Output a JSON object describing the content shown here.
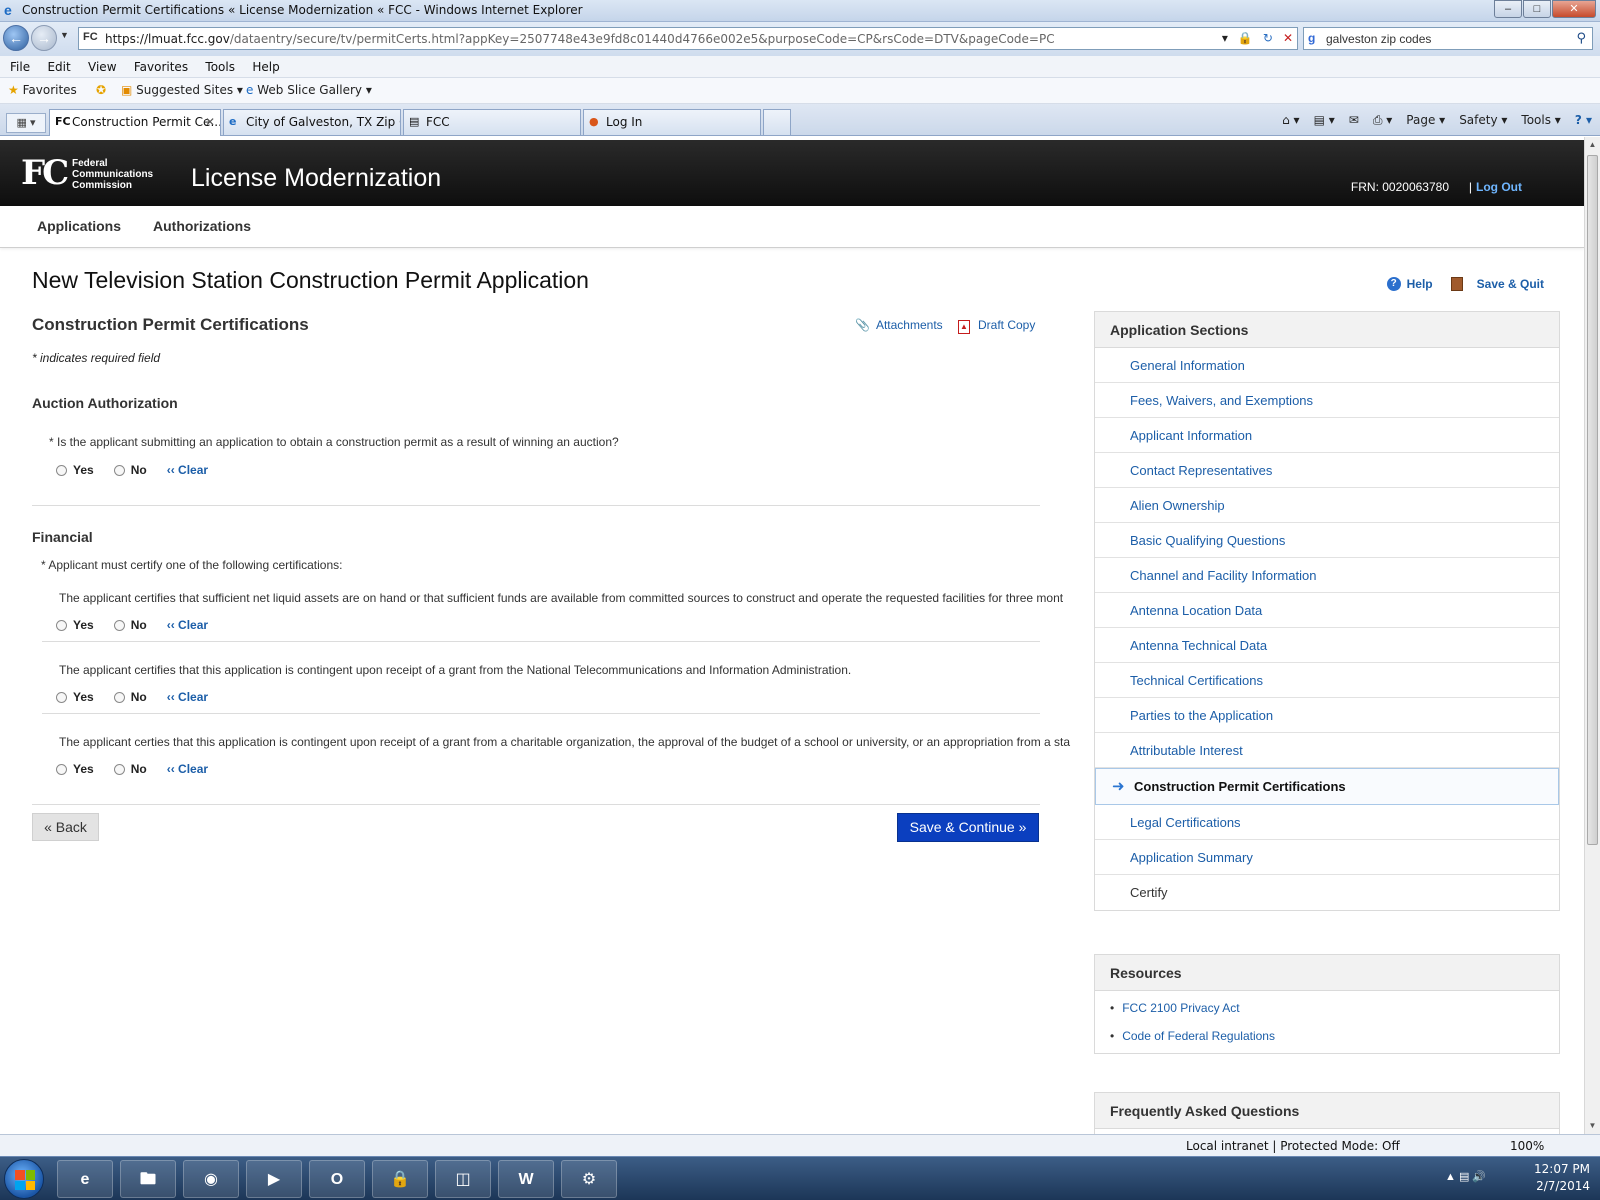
{
  "window": {
    "title": "Construction Permit Certifications « License Modernization « FCC - Windows Internet Explorer",
    "minimize": "–",
    "maximize": "□",
    "close": "✕"
  },
  "address": {
    "url_host": "https://lmuat.fcc.gov",
    "url_path": "/dataentry/secure/tv/permitCerts.html?appKey=2507748e43e9fd8c01440d4766e002e5&purposeCode=CP&rsCode=DTV&pageCode=PC",
    "search_text": "galveston zip codes"
  },
  "menubar": [
    "File",
    "Edit",
    "View",
    "Favorites",
    "Tools",
    "Help"
  ],
  "favorites_bar": {
    "favorites": "Favorites",
    "suggested": "Suggested Sites ▾",
    "webslice": "Web Slice Gallery ▾"
  },
  "tabs": [
    {
      "label": "Construction Permit Ce...",
      "icon": "FC"
    },
    {
      "label": "City of Galveston, TX Zip C...",
      "icon": "e"
    },
    {
      "label": "FCC",
      "icon": "▤"
    },
    {
      "label": "Log In",
      "icon": "●"
    }
  ],
  "command_bar": [
    "Page ▾",
    "Safety ▾",
    "Tools ▾",
    "? ▾"
  ],
  "header": {
    "logo": "FC",
    "logo_text_1": "Federal",
    "logo_text_2": "Communications",
    "logo_text_3": "Commission",
    "app_title": "License Modernization",
    "frn": "FRN: 0020063780",
    "separator": "|",
    "logout": "Log Out"
  },
  "subnav": {
    "applications": "Applications",
    "authorizations": "Authorizations"
  },
  "page": {
    "title": "New Television Station Construction Permit Application",
    "help": "Help",
    "save_quit": "Save & Quit",
    "section_title": "Construction Permit Certifications",
    "attachments": "Attachments",
    "draft_copy": "Draft Copy",
    "required_note": "* indicates required field"
  },
  "auction": {
    "title": "Auction Authorization",
    "question": "* Is the applicant submitting an application to obtain a construction permit as a result of winning an auction?"
  },
  "financial": {
    "title": "Financial",
    "instruction": "* Applicant must certify one of the following certifications:",
    "cert_1": "The applicant certifies that sufficient net liquid assets are on hand or that sufficient funds are available from committed sources to construct and operate the requested facilities for three mont",
    "cert_2": "The applicant certifies that this application is contingent upon receipt of a grant from the National Telecommunications and Information Administration.",
    "cert_3": "The applicant certies that this application is contingent upon receipt of a grant from a charitable organization, the approval of the budget of a school or university, or an appropriation from a sta"
  },
  "radio": {
    "yes": "Yes",
    "no": "No",
    "clear": "‹‹ Clear"
  },
  "buttons": {
    "back": "« Back",
    "save_continue": "Save & Continue »"
  },
  "sidebar": {
    "title": "Application Sections",
    "items": [
      "General Information",
      "Fees, Waivers, and Exemptions",
      "Applicant Information",
      "Contact Representatives",
      "Alien Ownership",
      "Basic Qualifying Questions",
      "Channel and Facility Information",
      "Antenna Location Data",
      "Antenna Technical Data",
      "Technical Certifications",
      "Parties to the Application",
      "Attributable Interest",
      "Construction Permit Certifications",
      "Legal Certifications",
      "Application Summary",
      "Certify"
    ]
  },
  "resources": {
    "title": "Resources",
    "links": [
      "FCC 2100 Privacy Act",
      "Code of Federal Regulations"
    ]
  },
  "faq": {
    "title": "Frequently Asked Questions"
  },
  "statusbar": {
    "zone": "Local intranet | Protected Mode: Off",
    "zoom": "100%"
  },
  "taskbar": {
    "time": "12:07 PM",
    "date": "2/7/2014"
  }
}
